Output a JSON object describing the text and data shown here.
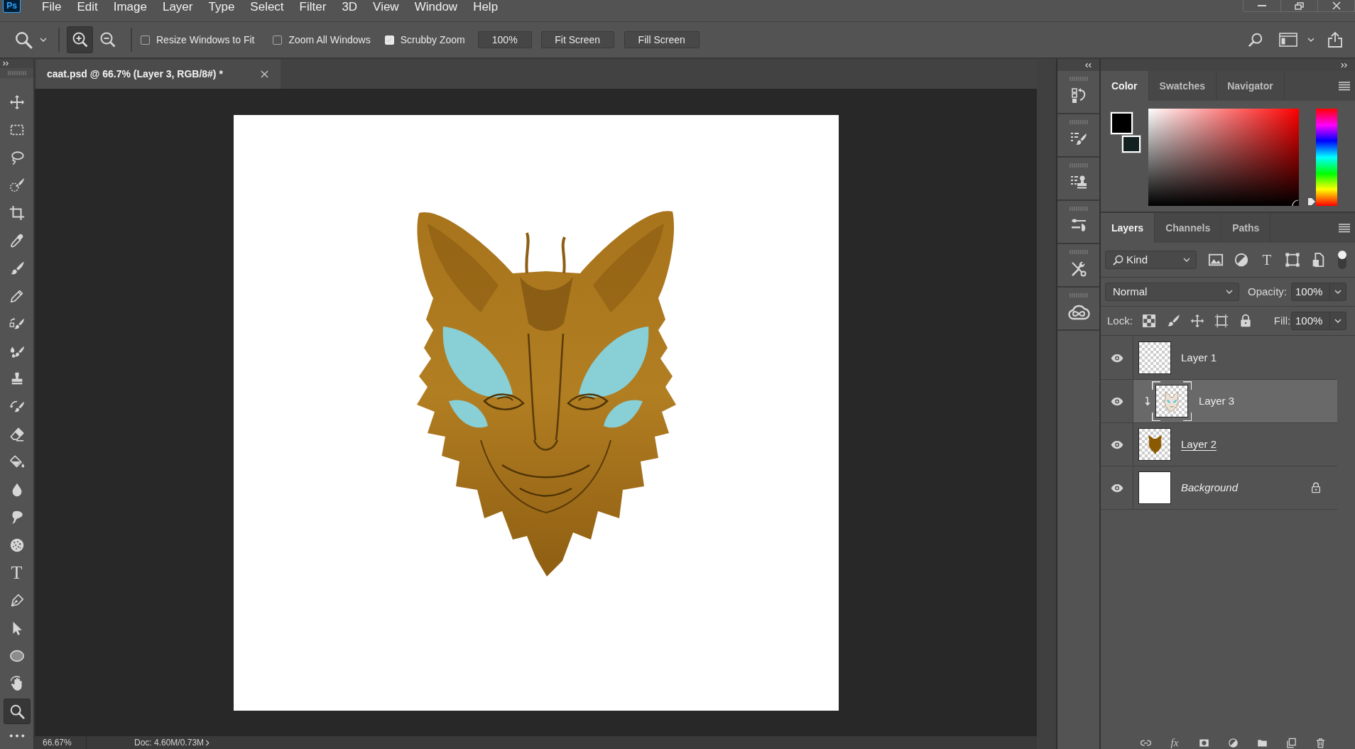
{
  "app": {
    "logo": "Ps"
  },
  "menu": [
    "File",
    "Edit",
    "Image",
    "Layer",
    "Type",
    "Select",
    "Filter",
    "3D",
    "View",
    "Window",
    "Help"
  ],
  "options_bar": {
    "zoom_modes": [
      {
        "kind": "zoom-in",
        "selected": true
      },
      {
        "kind": "zoom-out",
        "selected": false
      }
    ],
    "checkboxes": [
      {
        "label": "Resize Windows to Fit",
        "checked": false
      },
      {
        "label": "Zoom All Windows",
        "checked": false
      },
      {
        "label": "Scrubby Zoom",
        "checked": true
      }
    ],
    "zoom_field": "100%",
    "buttons": [
      "Fit Screen",
      "Fill Screen"
    ]
  },
  "document_tab": {
    "title": "caat.psd @ 66.7% (Layer 3, RGB/8#) *"
  },
  "tools": [
    {
      "kind": "move",
      "selected": false
    },
    {
      "kind": "marquee",
      "selected": false
    },
    {
      "kind": "lasso",
      "selected": false
    },
    {
      "kind": "quick-select",
      "selected": false
    },
    {
      "kind": "crop",
      "selected": false
    },
    {
      "kind": "eyedropper",
      "selected": false
    },
    {
      "kind": "brush",
      "selected": false
    },
    {
      "kind": "pencil",
      "selected": false
    },
    {
      "kind": "color-replacement",
      "selected": false
    },
    {
      "kind": "mixer-brush",
      "selected": false
    },
    {
      "kind": "clone-stamp",
      "selected": false
    },
    {
      "kind": "history-brush",
      "selected": false
    },
    {
      "kind": "eraser",
      "selected": false
    },
    {
      "kind": "paint-bucket",
      "selected": false
    },
    {
      "kind": "blur",
      "selected": false
    },
    {
      "kind": "smudge",
      "selected": false
    },
    {
      "kind": "sponge",
      "selected": false
    },
    {
      "kind": "type",
      "selected": false,
      "label": "T"
    },
    {
      "kind": "pen",
      "selected": false
    },
    {
      "kind": "path-selection",
      "selected": false
    },
    {
      "kind": "ellipse",
      "selected": false
    },
    {
      "kind": "rotate-view",
      "selected": false
    },
    {
      "kind": "zoom",
      "selected": true
    },
    {
      "kind": "more",
      "selected": false
    }
  ],
  "color_panel": {
    "tabs": [
      {
        "label": "Color",
        "selected": true
      },
      {
        "label": "Swatches",
        "selected": false
      },
      {
        "label": "Navigator",
        "selected": false
      }
    ],
    "swatches": [
      {
        "kind": "foreground",
        "color": "#000000"
      },
      {
        "kind": "background",
        "color": "#132121"
      }
    ],
    "hue": {
      "level": 0
    }
  },
  "layers_panel": {
    "tabs": [
      {
        "label": "Layers",
        "selected": true
      },
      {
        "label": "Channels",
        "selected": false
      },
      {
        "label": "Paths",
        "selected": false
      }
    ],
    "filter": {
      "label": "Kind",
      "on": true,
      "buttons": [
        {
          "kind": "pixel"
        },
        {
          "kind": "adjustment"
        },
        {
          "kind": "type",
          "label": "T"
        },
        {
          "kind": "shape"
        },
        {
          "kind": "smart-object"
        }
      ]
    },
    "blend_mode": "Normal",
    "opacity": {
      "label": "Opacity:",
      "value": "100%"
    },
    "lock": {
      "label": "Lock:"
    },
    "fill": {
      "label": "Fill:",
      "value": "100%"
    },
    "layers": [
      {
        "name": "Layer 1",
        "kind": "pixel",
        "thumbnail": {
          "kind": "transparent"
        },
        "visible": true,
        "selected": false,
        "clipped": false,
        "clip_base": false,
        "locked": false
      },
      {
        "name": "Layer 3",
        "kind": "pixel",
        "thumbnail": {
          "kind": "sketch"
        },
        "visible": true,
        "selected": true,
        "clipped": true,
        "clip_base": false,
        "locked": false
      },
      {
        "name": "Layer 2",
        "kind": "pixel",
        "thumbnail": {
          "kind": "silhouette"
        },
        "visible": true,
        "selected": false,
        "clipped": false,
        "clip_base": true,
        "locked": false
      },
      {
        "name": "Background",
        "kind": "background",
        "thumbnail": {
          "kind": "white"
        },
        "visible": true,
        "selected": false,
        "clipped": false,
        "clip_base": false,
        "locked": true
      }
    ],
    "footer": [
      {
        "kind": "link"
      },
      {
        "kind": "effects",
        "label": "fx"
      },
      {
        "kind": "mask"
      },
      {
        "kind": "adjustment"
      },
      {
        "kind": "group"
      },
      {
        "kind": "new"
      },
      {
        "kind": "delete"
      }
    ]
  },
  "status_bar": {
    "zoom": "66.67%",
    "document_size": "Doc: 4.60M/0.73M"
  }
}
